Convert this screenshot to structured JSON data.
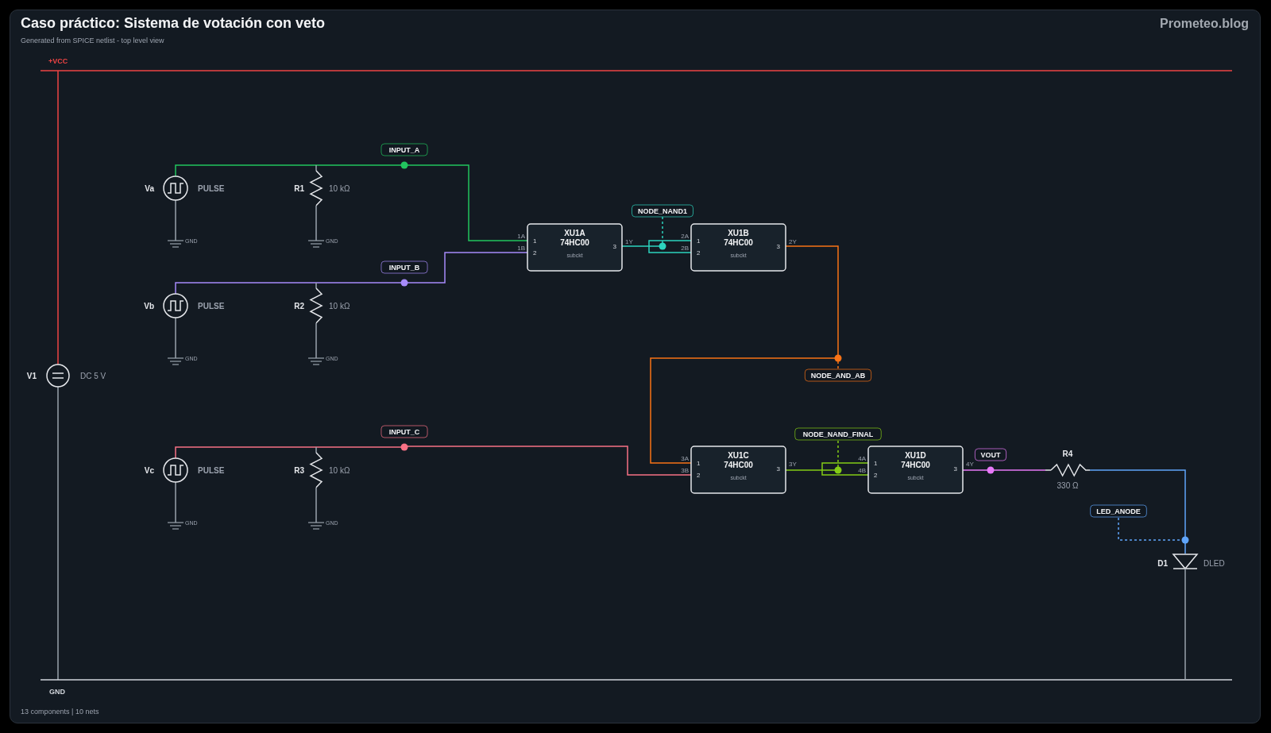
{
  "header": {
    "title": "Caso práctico: Sistema de votación con veto",
    "subtitle": "Generated from SPICE netlist - top level view",
    "brand": "Prometeo.blog"
  },
  "rails": {
    "vcc": "+VCC",
    "gnd": "GND"
  },
  "supply": {
    "ref": "V1",
    "value": "DC 5 V"
  },
  "inputs": [
    {
      "ref": "Va",
      "value": "PULSE",
      "ground": "GND",
      "resistor": {
        "ref": "R1",
        "value": "10 kΩ",
        "ground": "GND"
      },
      "net": {
        "label": "INPUT_A",
        "color": "#22c55e"
      }
    },
    {
      "ref": "Vb",
      "value": "PULSE",
      "ground": "GND",
      "resistor": {
        "ref": "R2",
        "value": "10 kΩ",
        "ground": "GND"
      },
      "net": {
        "label": "INPUT_B",
        "color": "#a78bfa"
      }
    },
    {
      "ref": "Vc",
      "value": "PULSE",
      "ground": "GND",
      "resistor": {
        "ref": "R3",
        "value": "10 kΩ",
        "ground": "GND"
      },
      "net": {
        "label": "INPUT_C",
        "color": "#f87185"
      }
    }
  ],
  "gates": [
    {
      "ref": "XU1A",
      "part": "74HC00",
      "model": "subckt",
      "pins": {
        "in_a": "1A",
        "in_b": "1B",
        "pin_a": "1",
        "pin_b": "2",
        "pin_out": "3",
        "out": "1Y"
      }
    },
    {
      "ref": "XU1B",
      "part": "74HC00",
      "model": "subckt",
      "pins": {
        "in_a": "2A",
        "in_b": "2B",
        "pin_a": "1",
        "pin_b": "2",
        "pin_out": "3",
        "out": "2Y"
      }
    },
    {
      "ref": "XU1C",
      "part": "74HC00",
      "model": "subckt",
      "pins": {
        "in_a": "3A",
        "in_b": "3B",
        "pin_a": "1",
        "pin_b": "2",
        "pin_out": "3",
        "out": "3Y"
      }
    },
    {
      "ref": "XU1D",
      "part": "74HC00",
      "model": "subckt",
      "pins": {
        "in_a": "4A",
        "in_b": "4B",
        "pin_a": "1",
        "pin_b": "2",
        "pin_out": "3",
        "out": "4Y"
      }
    }
  ],
  "nets": [
    {
      "label": "NODE_NAND1",
      "color": "#2dd4bf"
    },
    {
      "label": "NODE_AND_AB",
      "color": "#f97316"
    },
    {
      "label": "NODE_NAND_FINAL",
      "color": "#84cc16"
    },
    {
      "label": "VOUT",
      "color": "#e879f9"
    },
    {
      "label": "LED_ANODE",
      "color": "#60a5fa"
    }
  ],
  "load": {
    "resistor": {
      "ref": "R4",
      "value": "330 Ω"
    },
    "diode": {
      "ref": "D1",
      "value": "DLED"
    }
  },
  "footer": "13 components | 10 nets"
}
